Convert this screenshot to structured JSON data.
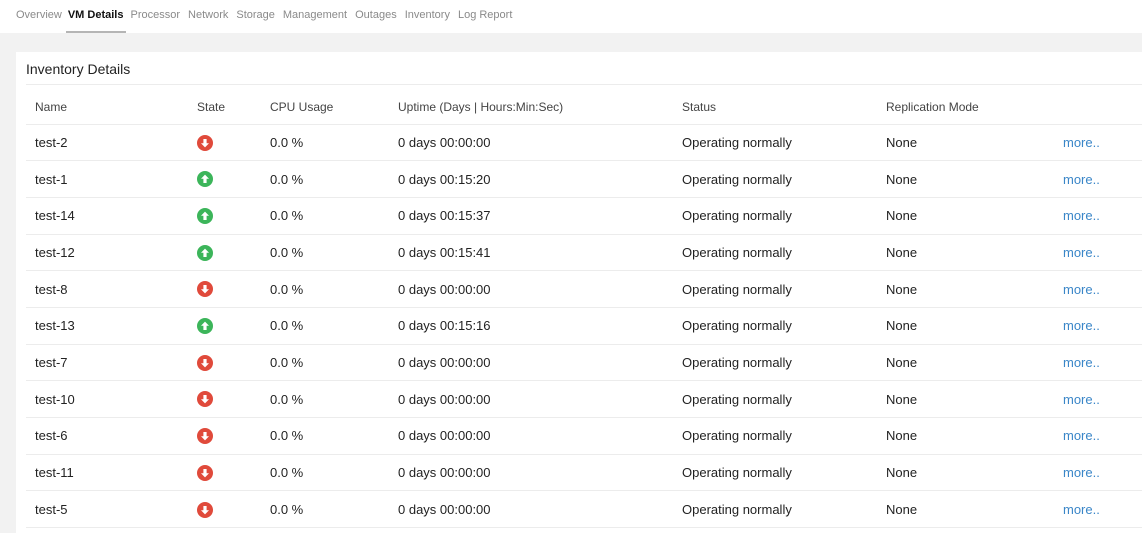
{
  "tabs": [
    {
      "label": "Overview",
      "active": false
    },
    {
      "label": "VM Details",
      "active": true
    },
    {
      "label": "Processor",
      "active": false
    },
    {
      "label": "Network",
      "active": false
    },
    {
      "label": "Storage",
      "active": false
    },
    {
      "label": "Management",
      "active": false
    },
    {
      "label": "Outages",
      "active": false
    },
    {
      "label": "Inventory",
      "active": false
    },
    {
      "label": "Log Report",
      "active": false
    }
  ],
  "panel": {
    "title": "Inventory Details"
  },
  "table": {
    "headers": {
      "name": "Name",
      "state": "State",
      "cpu": "CPU Usage",
      "uptime": "Uptime (Days | Hours:Min:Sec)",
      "status": "Status",
      "replication": "Replication Mode"
    },
    "rows": [
      {
        "name": "test-2",
        "state": "down",
        "cpu": "0.0 %",
        "uptime": "0 days 00:00:00",
        "status": "Operating normally",
        "replication": "None",
        "more": "more.."
      },
      {
        "name": "test-1",
        "state": "up",
        "cpu": "0.0 %",
        "uptime": "0 days 00:15:20",
        "status": "Operating normally",
        "replication": "None",
        "more": "more.."
      },
      {
        "name": "test-14",
        "state": "up",
        "cpu": "0.0 %",
        "uptime": "0 days 00:15:37",
        "status": "Operating normally",
        "replication": "None",
        "more": "more.."
      },
      {
        "name": "test-12",
        "state": "up",
        "cpu": "0.0 %",
        "uptime": "0 days 00:15:41",
        "status": "Operating normally",
        "replication": "None",
        "more": "more.."
      },
      {
        "name": "test-8",
        "state": "down",
        "cpu": "0.0 %",
        "uptime": "0 days 00:00:00",
        "status": "Operating normally",
        "replication": "None",
        "more": "more.."
      },
      {
        "name": "test-13",
        "state": "up",
        "cpu": "0.0 %",
        "uptime": "0 days 00:15:16",
        "status": "Operating normally",
        "replication": "None",
        "more": "more.."
      },
      {
        "name": "test-7",
        "state": "down",
        "cpu": "0.0 %",
        "uptime": "0 days 00:00:00",
        "status": "Operating normally",
        "replication": "None",
        "more": "more.."
      },
      {
        "name": "test-10",
        "state": "down",
        "cpu": "0.0 %",
        "uptime": "0 days 00:00:00",
        "status": "Operating normally",
        "replication": "None",
        "more": "more.."
      },
      {
        "name": "test-6",
        "state": "down",
        "cpu": "0.0 %",
        "uptime": "0 days 00:00:00",
        "status": "Operating normally",
        "replication": "None",
        "more": "more.."
      },
      {
        "name": "test-11",
        "state": "down",
        "cpu": "0.0 %",
        "uptime": "0 days 00:00:00",
        "status": "Operating normally",
        "replication": "None",
        "more": "more.."
      },
      {
        "name": "test-5",
        "state": "down",
        "cpu": "0.0 %",
        "uptime": "0 days 00:00:00",
        "status": "Operating normally",
        "replication": "None",
        "more": "more.."
      }
    ]
  },
  "icons": {
    "up": "arrow-up-circle-icon",
    "down": "arrow-down-circle-icon"
  },
  "colors": {
    "state_up": "#3cb55a",
    "state_down": "#e04a3b",
    "link": "#3a86c8",
    "active_tab_underline": "#b5b5b5"
  }
}
